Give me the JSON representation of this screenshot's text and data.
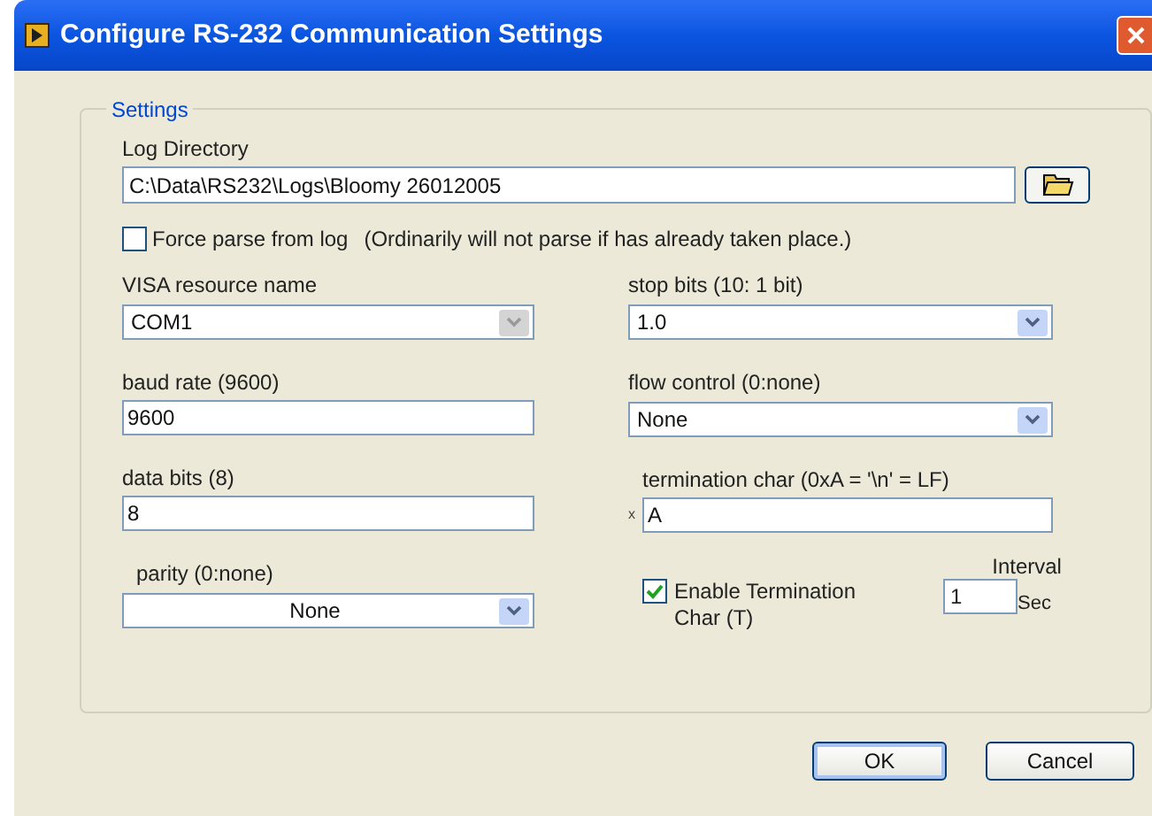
{
  "window": {
    "title": "Configure RS-232 Communication Settings"
  },
  "group": {
    "title": "Settings"
  },
  "log_directory": {
    "label": "Log Directory",
    "value": "C:\\Data\\RS232\\Logs\\Bloomy 26012005"
  },
  "force_parse": {
    "label": "Force parse from log",
    "checked": false,
    "note": "(Ordinarily will not parse if has already taken place.)"
  },
  "left_fields": [
    {
      "kind": "dropdown",
      "label": "VISA resource name",
      "value": "COM1",
      "disabled": true,
      "centered": false
    },
    {
      "kind": "text",
      "label": "baud rate (9600)",
      "value": "9600"
    },
    {
      "kind": "text",
      "label": "data bits (8)",
      "value": "8"
    },
    {
      "kind": "dropdown",
      "label": "parity (0:none)",
      "value": "None",
      "disabled": false,
      "centered": true
    }
  ],
  "right_fields": [
    {
      "kind": "dropdown",
      "label": "stop bits (10: 1 bit)",
      "value": "1.0",
      "disabled": false,
      "centered": false
    },
    {
      "kind": "dropdown",
      "label": "flow control (0:none)",
      "value": "None",
      "disabled": false,
      "centered": false
    },
    {
      "kind": "text",
      "label": "termination char (0xA = '\\n' = LF)",
      "value": "A",
      "prefix": "x"
    }
  ],
  "enable_termination": {
    "label": "Enable Termination Char (T)",
    "checked": true
  },
  "interval": {
    "label": "Interval",
    "value": "1",
    "unit": "Sec"
  },
  "buttons": [
    {
      "label": "OK",
      "default": true
    },
    {
      "label": "Cancel",
      "default": false
    }
  ]
}
